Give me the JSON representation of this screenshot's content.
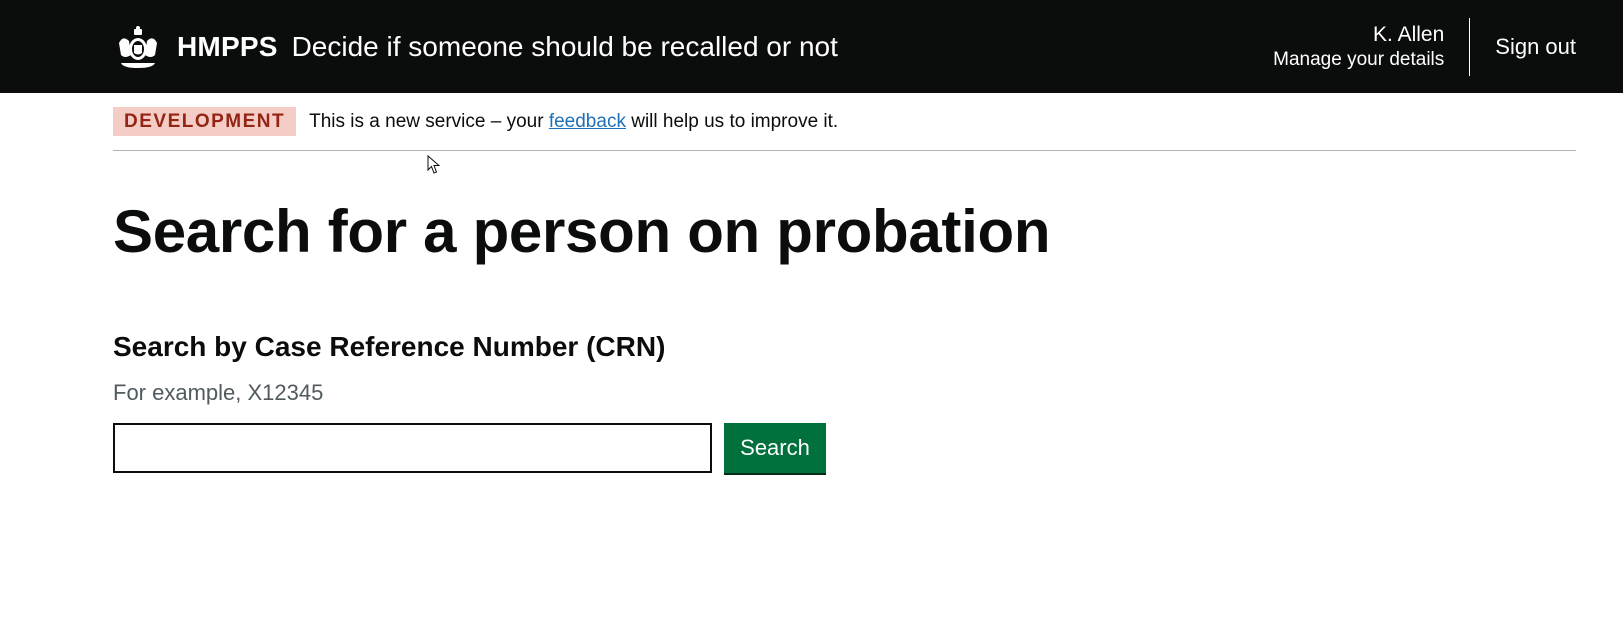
{
  "header": {
    "brand": "HMPPS",
    "service_name": "Decide if someone should be recalled or not",
    "user_name": "K. Allen",
    "manage_details": "Manage your details",
    "sign_out": "Sign out",
    "crest_icon": "royal-crest-icon"
  },
  "phase_banner": {
    "tag": "DEVELOPMENT",
    "text_before": "This is a new service – your ",
    "link": "feedback",
    "text_after": " will help us to improve it."
  },
  "main": {
    "title": "Search for a person on probation",
    "field_label": "Search by Case Reference Number (CRN)",
    "hint": "For example, X12345",
    "input_value": "",
    "button_label": "Search"
  },
  "colors": {
    "header_bg": "#0b0c0c",
    "tag_bg": "#f4cdc6",
    "tag_text": "#942514",
    "link": "#1d70b8",
    "button": "#00703c"
  }
}
